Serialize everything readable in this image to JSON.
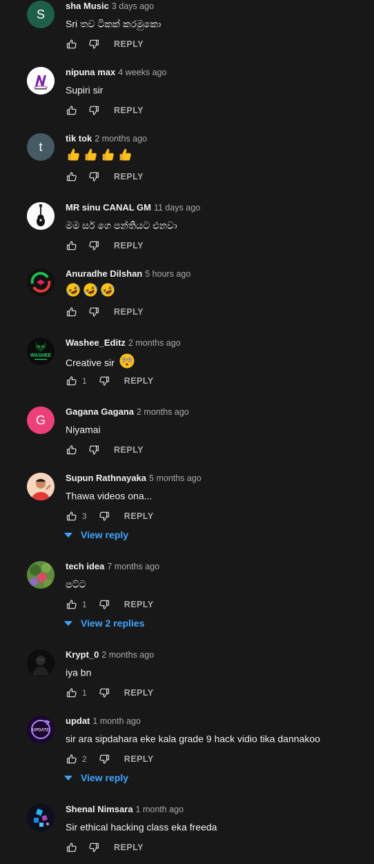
{
  "comments": [
    {
      "author": "sha Music",
      "time": "3 days ago",
      "text": "Sri තව ටිකක් කරමුකො",
      "likes": "",
      "reply_label": "REPLY",
      "avatar_color": "#1e5f4a",
      "avatar_letter": "S",
      "avatar_icon": "letter"
    },
    {
      "author": "nipuna max",
      "time": "4 weeks ago",
      "text": "Supiri sir",
      "likes": "",
      "reply_label": "REPLY",
      "avatar_color": "#ffffff",
      "avatar_letter": "",
      "avatar_icon": "nipuna-logo"
    },
    {
      "author": "tik tok",
      "time": "2 months ago",
      "text": "",
      "emoji": [
        "thumbs",
        "thumbs",
        "thumbs",
        "thumbs"
      ],
      "likes": "",
      "reply_label": "REPLY",
      "avatar_color": "#455a64",
      "avatar_letter": "t",
      "avatar_icon": "letter"
    },
    {
      "author": "MR sinu CANAL GM",
      "time": "11 days ago",
      "text": "මම සර් ගෙ පන්තියට එනවා",
      "likes": "",
      "reply_label": "REPLY",
      "avatar_color": "#ffffff",
      "avatar_letter": "",
      "avatar_icon": "guitar"
    },
    {
      "author": "Anuradhe Dilshan",
      "time": "5 hours ago",
      "text": "",
      "emoji": [
        "rofl",
        "rofl",
        "rofl"
      ],
      "likes": "",
      "reply_label": "REPLY",
      "avatar_color": "#111111",
      "avatar_letter": "",
      "avatar_icon": "swirl-logo"
    },
    {
      "author": "Washee_Editz",
      "time": "2 months ago",
      "text": "Creative sir",
      "emoji_after": "flushed",
      "likes": "1",
      "reply_label": "REPLY",
      "avatar_color": "#0d0d0d",
      "avatar_letter": "",
      "avatar_icon": "washee-logo",
      "avatar_caption": "WASHEE"
    },
    {
      "author": "Gagana Gagana",
      "time": "2 months ago",
      "text": "Niyamai",
      "likes": "",
      "reply_label": "REPLY",
      "avatar_color": "#ec407a",
      "avatar_letter": "G",
      "avatar_icon": "letter"
    },
    {
      "author": "Supun Rathnayaka",
      "time": "5 months ago",
      "text": "Thawa videos ona...",
      "likes": "3",
      "reply_label": "REPLY",
      "avatar_color": "#f3d9c6",
      "avatar_letter": "",
      "avatar_icon": "person-photo",
      "view_replies": "View reply"
    },
    {
      "author": "tech idea",
      "time": "7 months ago",
      "text": "පට්ට",
      "likes": "1",
      "reply_label": "REPLY",
      "avatar_color": "#4f7b3a",
      "avatar_letter": "",
      "avatar_icon": "nature-photo",
      "view_replies": "View 2 replies"
    },
    {
      "author": "Krypt_0",
      "time": "2 months ago",
      "text": "iya bn",
      "likes": "1",
      "reply_label": "REPLY",
      "avatar_color": "#101010",
      "avatar_letter": "",
      "avatar_icon": "dark-figure"
    },
    {
      "author": "updat",
      "time": "1 month ago",
      "text": "sir ara sipdahara eke kala grade 9 hack vidio tika dannakoo",
      "likes": "2",
      "reply_label": "REPLY",
      "avatar_color": "#1a0830",
      "avatar_letter": "",
      "avatar_icon": "update-logo",
      "avatar_caption": "UPDATE",
      "view_replies": "View reply"
    },
    {
      "author": "Shenal Nimsara",
      "time": "1 month ago",
      "text": "Sir ethical hacking class eka freeda",
      "likes": "",
      "reply_label": "REPLY",
      "avatar_color": "#0b0f1e",
      "avatar_letter": "",
      "avatar_icon": "blocks-logo"
    }
  ]
}
